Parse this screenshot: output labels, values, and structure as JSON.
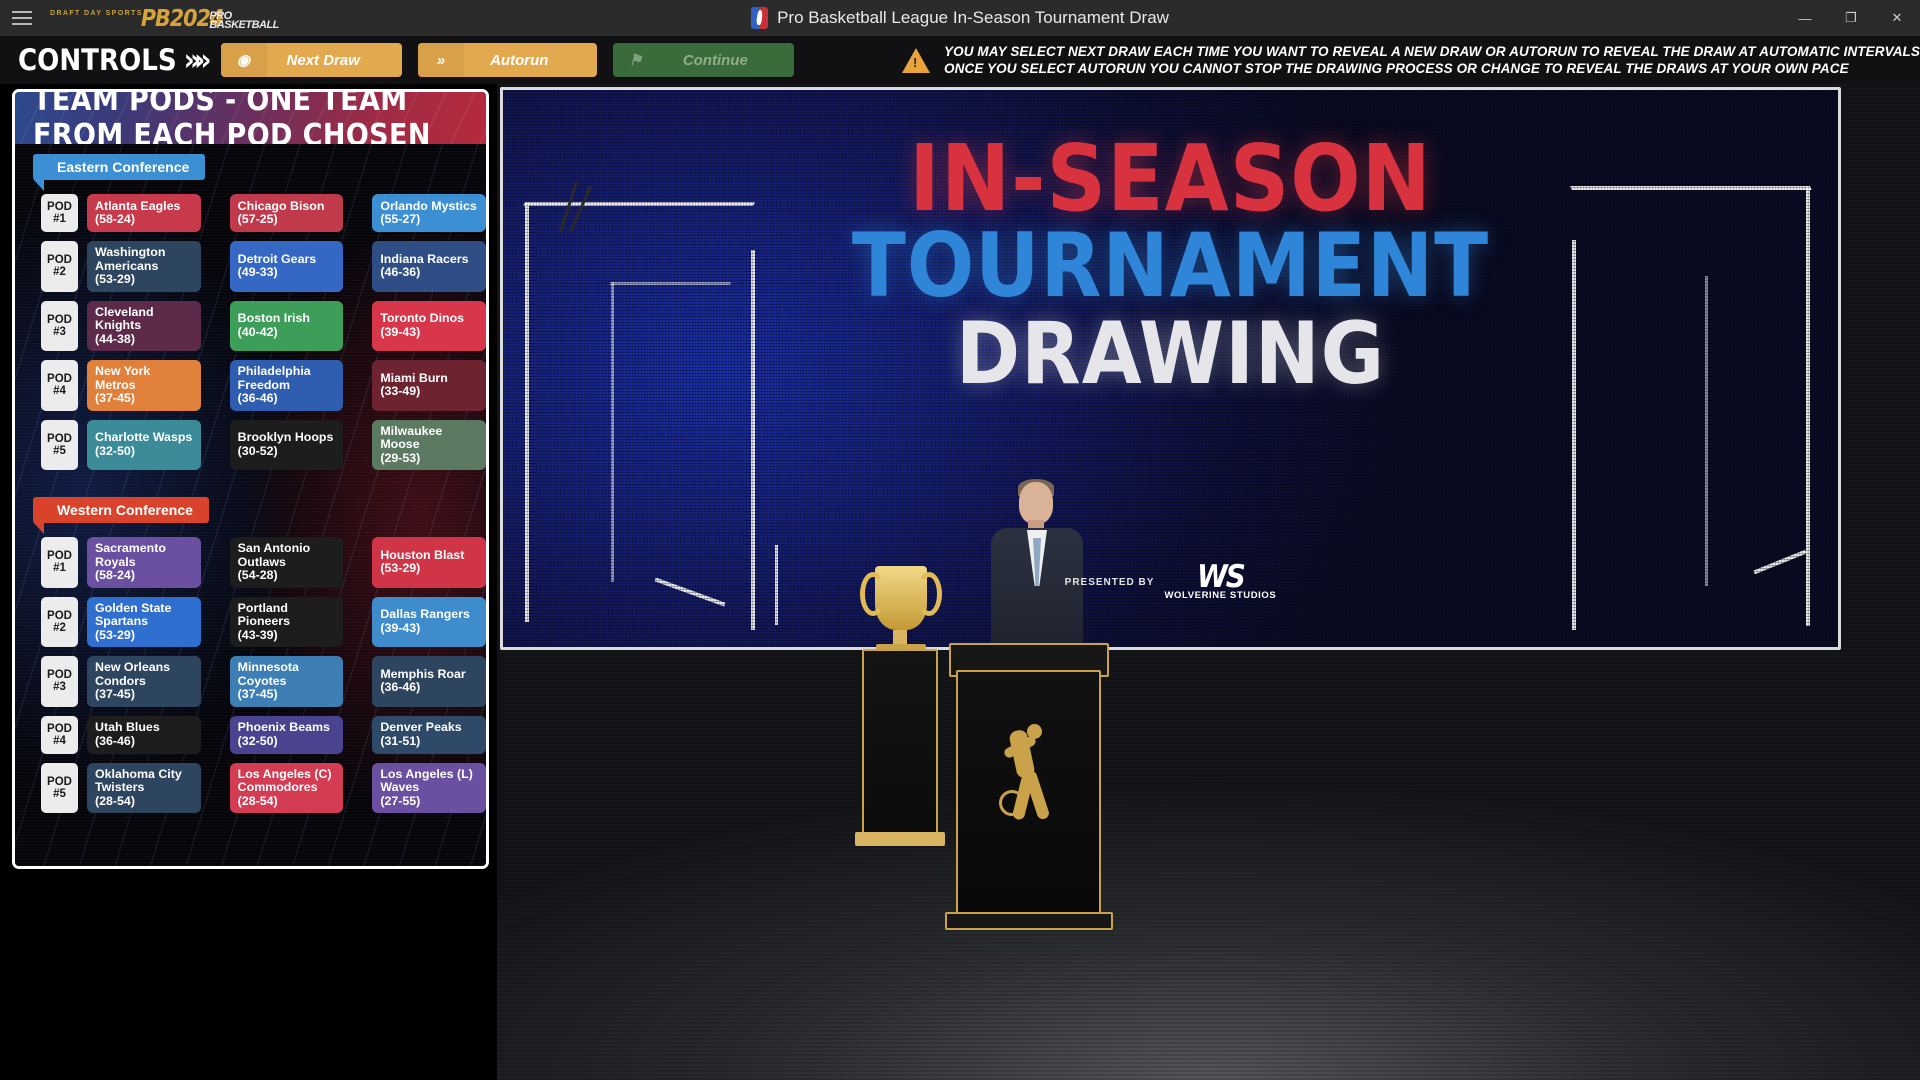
{
  "titlebar": {
    "menu_icon": "hamburger-icon",
    "brand_tagline": "DRAFT DAY SPORTS",
    "brand_pb": "PB2024",
    "brand_pro": "PRO",
    "brand_basketball": "BASKETBALL",
    "app_title": "Pro Basketball League In-Season Tournament Draw",
    "minimize": "—",
    "maximize": "❐",
    "close": "✕"
  },
  "controls": {
    "label": "CONTROLS",
    "chevrons": "»",
    "next_draw": {
      "label": "Next Draw",
      "icon": "play-circle-icon"
    },
    "autorun": {
      "label": "Autorun",
      "icon": "double-chevron-icon"
    },
    "continue": {
      "label": "Continue",
      "icon": "checkered-flag-icon"
    },
    "warning_icon": "warning-triangle-icon",
    "warning_line1": "YOU MAY SELECT NEXT DRAW EACH TIME YOU WANT TO REVEAL A NEW DRAW OR AUTORUN TO REVEAL THE DRAW AT AUTOMATIC INTERVALS",
    "warning_line2": "ONCE YOU SELECT AUTORUN YOU CANNOT STOP THE DRAWING PROCESS OR CHANGE TO REVEAL THE DRAWS AT YOUR OWN PACE"
  },
  "pods_panel": {
    "title": "TEAM PODS - ONE TEAM FROM EACH POD CHOSEN",
    "eastern_label": "Eastern Conference",
    "western_label": "Western Conference",
    "eastern": [
      {
        "pod": "POD",
        "num": "#1",
        "teams": [
          {
            "name": "Atlanta Eagles",
            "record": "(58-24)",
            "color": "#c8394b"
          },
          {
            "name": "Chicago Bison",
            "record": "(57-25)",
            "color": "#c03a4c"
          },
          {
            "name": "Orlando Mystics",
            "record": "(55-27)",
            "color": "#3d8fd4"
          }
        ]
      },
      {
        "pod": "POD",
        "num": "#2",
        "teams": [
          {
            "name": "Washington Americans",
            "record": "(53-29)",
            "color": "#2e4560"
          },
          {
            "name": "Detroit Gears",
            "record": "(49-33)",
            "color": "#3568c4"
          },
          {
            "name": "Indiana Racers",
            "record": "(46-36)",
            "color": "#2f4e86"
          }
        ]
      },
      {
        "pod": "POD",
        "num": "#3",
        "teams": [
          {
            "name": "Cleveland Knights",
            "record": "(44-38)",
            "color": "#5d2a4a"
          },
          {
            "name": "Boston Irish",
            "record": "(40-42)",
            "color": "#3d9e5a"
          },
          {
            "name": "Toronto Dinos",
            "record": "(39-43)",
            "color": "#d8364a"
          }
        ]
      },
      {
        "pod": "POD",
        "num": "#4",
        "teams": [
          {
            "name": "New York Metros",
            "record": "(37-45)",
            "color": "#e1803a"
          },
          {
            "name": "Philadelphia Freedom",
            "record": "(36-46)",
            "color": "#2f5db0"
          },
          {
            "name": "Miami Burn",
            "record": "(33-49)",
            "color": "#6d2430"
          }
        ]
      },
      {
        "pod": "POD",
        "num": "#5",
        "teams": [
          {
            "name": "Charlotte Wasps",
            "record": "(32-50)",
            "color": "#3b8b98"
          },
          {
            "name": "Brooklyn Hoops",
            "record": "(30-52)",
            "color": "#1d1d1d"
          },
          {
            "name": "Milwaukee Moose",
            "record": "(29-53)",
            "color": "#5c7a62"
          }
        ]
      }
    ],
    "western": [
      {
        "pod": "POD",
        "num": "#1",
        "teams": [
          {
            "name": "Sacramento Royals",
            "record": "(58-24)",
            "color": "#6b4fa0"
          },
          {
            "name": "San Antonio Outlaws",
            "record": "(54-28)",
            "color": "#1d1d1d"
          },
          {
            "name": "Houston Blast",
            "record": "(53-29)",
            "color": "#cf3547"
          }
        ]
      },
      {
        "pod": "POD",
        "num": "#2",
        "teams": [
          {
            "name": "Golden State Spartans",
            "record": "(53-29)",
            "color": "#2f6fd0"
          },
          {
            "name": "Portland Pioneers",
            "record": "(43-39)",
            "color": "#1d1d1d"
          },
          {
            "name": "Dallas Rangers",
            "record": "(39-43)",
            "color": "#3f8ccc"
          }
        ]
      },
      {
        "pod": "POD",
        "num": "#3",
        "teams": [
          {
            "name": "New Orleans Condors",
            "record": "(37-45)",
            "color": "#2e4560"
          },
          {
            "name": "Minnesota Coyotes",
            "record": "(37-45)",
            "color": "#3d7fb5"
          },
          {
            "name": "Memphis Roar",
            "record": "(36-46)",
            "color": "#2e4560"
          }
        ]
      },
      {
        "pod": "POD",
        "num": "#4",
        "teams": [
          {
            "name": "Utah Blues",
            "record": "(36-46)",
            "color": "#1d1d1d"
          },
          {
            "name": "Phoenix Beams",
            "record": "(32-50)",
            "color": "#4a4490"
          },
          {
            "name": "Denver Peaks",
            "record": "(31-51)",
            "color": "#2e4a68"
          }
        ]
      },
      {
        "pod": "POD",
        "num": "#5",
        "teams": [
          {
            "name": "Oklahoma City Twisters",
            "record": "(28-54)",
            "color": "#2e4560"
          },
          {
            "name": "Los Angeles (C) Commodores",
            "record": "(28-54)",
            "color": "#d43c54"
          },
          {
            "name": "Los Angeles (L) Waves",
            "record": "(27-55)",
            "color": "#6b4fa0"
          }
        ]
      }
    ]
  },
  "stage": {
    "tv_line1": "IN-SEASON",
    "tv_line2": "TOURNAMENT",
    "tv_line3": "DRAWING",
    "presented_by": "PRESENTED BY",
    "studio_mark": "WS",
    "studio_name": "WOLVERINE STUDIOS"
  }
}
